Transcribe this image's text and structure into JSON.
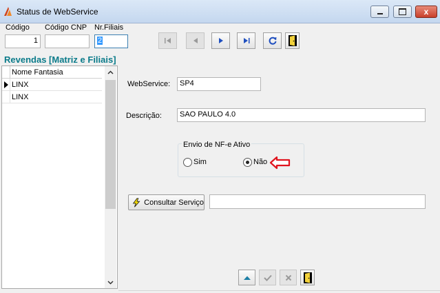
{
  "window": {
    "title": "Status de WebService",
    "close_label": "x"
  },
  "header": {
    "codigo_label": "Código",
    "codigo_value": "1",
    "codigo_cnp_label": "Código CNP",
    "codigo_cnp_value": "",
    "nr_filiais_label": "Nr.Filiais",
    "nr_filiais_value": "2"
  },
  "toolbar": {
    "buttons": [
      {
        "name": "first",
        "icon": "first-record-icon",
        "enabled": false
      },
      {
        "name": "previous",
        "icon": "previous-record-icon",
        "enabled": false
      },
      {
        "name": "next",
        "icon": "next-record-icon",
        "enabled": true
      },
      {
        "name": "last",
        "icon": "last-record-icon",
        "enabled": true
      },
      {
        "name": "refresh",
        "icon": "refresh-icon",
        "enabled": true
      },
      {
        "name": "exit",
        "icon": "exit-door-icon",
        "enabled": true
      }
    ]
  },
  "revendas": {
    "title": "Revendas [Matriz e Filiais]",
    "column": "Nome Fantasia",
    "rows": [
      "LINX",
      "LINX"
    ],
    "current_row": 0
  },
  "form": {
    "webservice_label": "WebService:",
    "webservice_value": "SP4",
    "descricao_label": "Descrição:",
    "descricao_value": "SAO PAULO 4.0",
    "envio_group_label": "Envio de NF-e Ativo",
    "sim_label": "Sim",
    "nao_label": "Não",
    "selected_option": "Não",
    "consultar_label": "Consultar Serviço",
    "consultar_result": ""
  },
  "bottom_buttons": [
    {
      "name": "up",
      "icon": "up-triangle-icon",
      "enabled": true
    },
    {
      "name": "confirm",
      "icon": "check-icon",
      "enabled": false
    },
    {
      "name": "cancel",
      "icon": "x-icon",
      "enabled": false
    },
    {
      "name": "exit",
      "icon": "exit-door-icon",
      "enabled": true
    }
  ],
  "colors": {
    "panel_title": "#0b7b8a",
    "selection": "#3399ff",
    "annotation_arrow": "#e0141e"
  }
}
